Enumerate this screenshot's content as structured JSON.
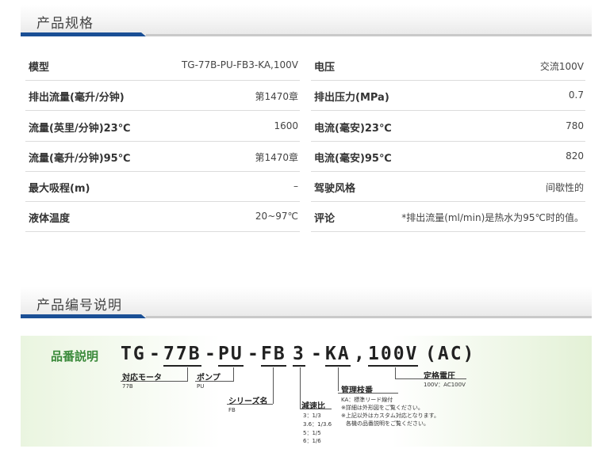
{
  "spec": {
    "title": "产品规格",
    "rows": [
      {
        "left_label": "模型",
        "left_value": "TG-77B-PU-FB3-KA,100V",
        "right_label": "电压",
        "right_value": "交流100V"
      },
      {
        "left_label": "排出流量(毫升/分钟)",
        "left_value": "第1470章",
        "right_label": "排出压力(MPa)",
        "right_value": "0.7"
      },
      {
        "left_label": "流量(英里/分钟)23℃",
        "left_value": "1600",
        "right_label": "电流(毫安)23℃",
        "right_value": "780"
      },
      {
        "left_label": "流量(毫升/分钟)95℃",
        "left_value": "第1470章",
        "right_label": "电流(毫安)95℃",
        "right_value": "820"
      },
      {
        "left_label": "最大吸程(m)",
        "left_value": "–",
        "right_label": "驾驶风格",
        "right_value": "间歇性的"
      },
      {
        "left_label": "液体温度",
        "left_value": "20~97℃",
        "right_label": "评论",
        "right_value": "*排出流量(ml/min)是热水为95℃时的值。"
      }
    ]
  },
  "code": {
    "title": "产品编号说明",
    "label": "品番説明",
    "parts": {
      "p1": "TG",
      "d1": "-",
      "p2": "77B",
      "d2": "-",
      "p3": "PU",
      "d3": "-",
      "p4": "FB",
      "p5": "3",
      "d4": "-",
      "p6": "KA",
      "comma": ",",
      "p7": "100V",
      "p8": "(AC)"
    },
    "annotations": {
      "motor": {
        "title": "対応モータ",
        "sub": "77B"
      },
      "pump": {
        "title": "ポンプ",
        "sub": "PU"
      },
      "series": {
        "title": "シリーズ名",
        "sub": "FB"
      },
      "ratio": {
        "title": "減速比",
        "items": [
          "3：1/3",
          "3.6：1/3.6",
          "5：1/5",
          "6：1/6"
        ]
      },
      "spec": {
        "title": "管理枝番",
        "items": [
          "KA：標準リード線付",
          "※詳細は外形図をご覧ください。",
          "※上記以外はカスタム対応となります。",
          "各機の品番説明をご覧ください。"
        ]
      },
      "voltage": {
        "title": "定格電圧",
        "sub": "100V：AC100V"
      }
    }
  }
}
